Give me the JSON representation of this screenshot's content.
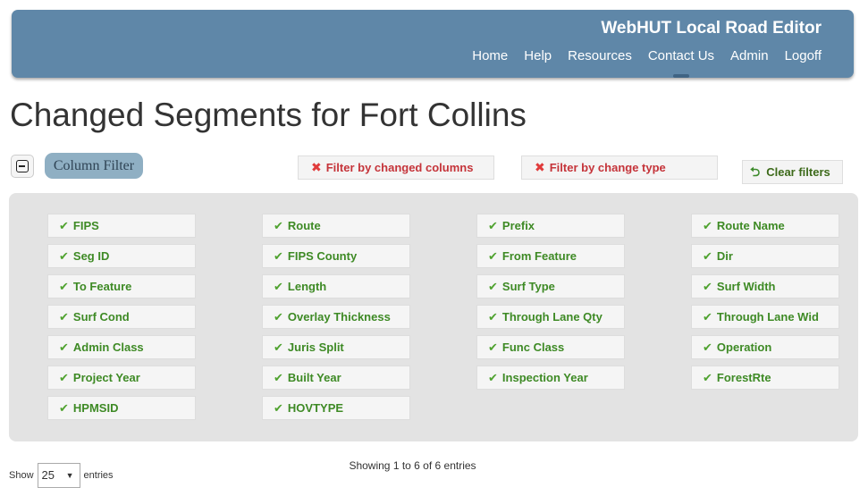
{
  "header": {
    "brand": "WebHUT Local Road Editor",
    "nav": [
      "Home",
      "Help",
      "Resources",
      "Contact Us",
      "Admin",
      "Logoff"
    ]
  },
  "page_title": "Changed Segments for Fort Collins",
  "filters": {
    "column_filter_label": "Column Filter",
    "by_columns_label": "Filter by changed columns",
    "by_type_label": "Filter by change type",
    "clear_label": "Clear filters"
  },
  "columns": [
    [
      "FIPS",
      "Seg ID",
      "To Feature",
      "Surf Cond",
      "Admin Class",
      "Project Year",
      "HPMSID"
    ],
    [
      "Route",
      "FIPS County",
      "Length",
      "Overlay Thickness",
      "Juris Split",
      "Built Year",
      "HOVTYPE"
    ],
    [
      "Prefix",
      "From Feature",
      "Surf Type",
      "Through Lane Qty",
      "Func Class",
      "Inspection Year"
    ],
    [
      "Route Name",
      "Dir",
      "Surf Width",
      "Through Lane Wid",
      "Operation",
      "ForestRte"
    ]
  ],
  "table": {
    "info": "Showing 1 to 6 of 6 entries",
    "show_label": "Show",
    "page_length": "25",
    "entries_label": "entries"
  },
  "colors": {
    "navbar": "#5f87a8",
    "column_green": "#3e8a25",
    "filter_red": "#c5343a"
  }
}
